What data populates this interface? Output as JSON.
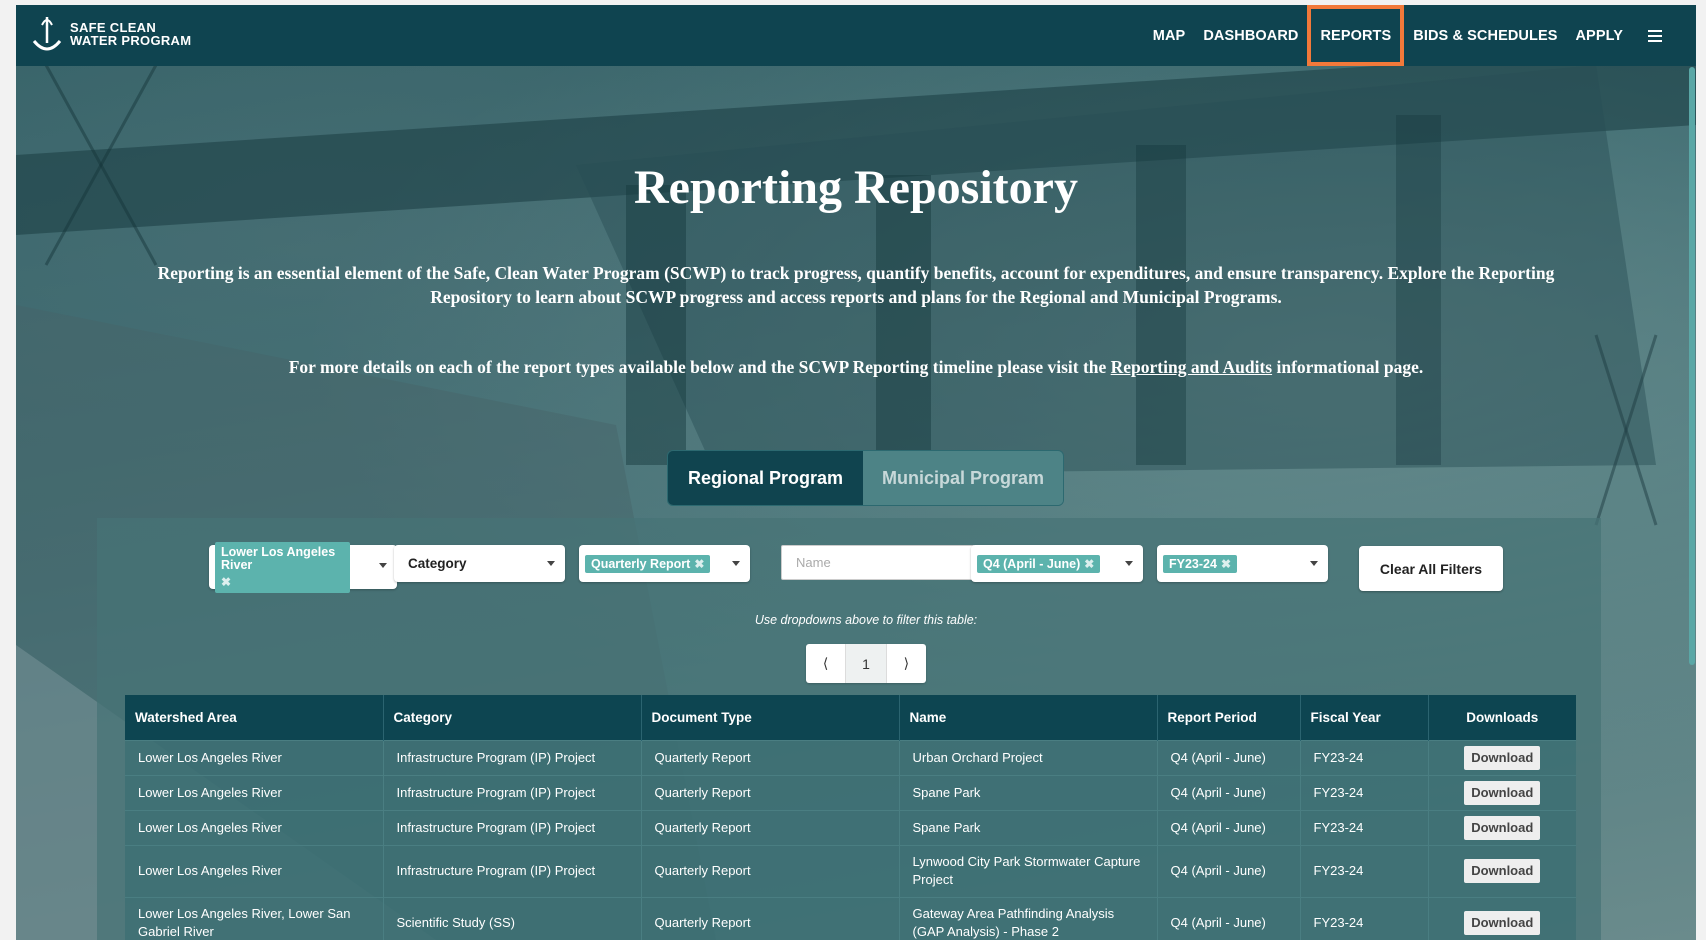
{
  "brand": {
    "logo_text": "SAFE CLEAN\nWATER PROGRAM"
  },
  "nav": {
    "items": [
      "MAP",
      "DASHBOARD",
      "REPORTS",
      "BIDS & SCHEDULES",
      "APPLY"
    ],
    "active": "REPORTS"
  },
  "hero": {
    "title": "Reporting Repository",
    "description": "Reporting is an essential element of the Safe, Clean Water Program (SCWP) to track progress, quantify benefits, account for expenditures, and ensure transparency. Explore the Reporting Repository to learn about SCWP progress and access reports and plans for the Regional and Municipal Programs.",
    "details_prefix": "For more details on each of the report types available below and the SCWP Reporting timeline please visit the",
    "details_link": "Reporting and Audits",
    "details_suffix": "informational page."
  },
  "program_tabs": {
    "regional": "Regional Program",
    "municipal": "Municipal Program"
  },
  "filters": {
    "watershed_chip": "Lower Los Angeles River",
    "category_label": "Category",
    "doc_type_chip": "Quarterly Report",
    "name_placeholder": "Name",
    "period_chip": "Q4 (April - June)",
    "fiscal_chip": "FY23-24",
    "clear_label": "Clear All Filters",
    "chip_remove": "✖"
  },
  "hint": "Use dropdowns above to filter this table:",
  "pager": {
    "prev": "⟨",
    "page": "1",
    "next": "⟩"
  },
  "table": {
    "headers": [
      "Watershed Area",
      "Category",
      "Document Type",
      "Name",
      "Report Period",
      "Fiscal Year",
      "Downloads"
    ],
    "download_label": "Download",
    "rows": [
      {
        "watershed": "Lower Los Angeles River",
        "category": "Infrastructure Program (IP) Project",
        "doc_type": "Quarterly Report",
        "name": "Urban Orchard Project",
        "period": "Q4 (April - June)",
        "fiscal": "FY23-24"
      },
      {
        "watershed": "Lower Los Angeles River",
        "category": "Infrastructure Program (IP) Project",
        "doc_type": "Quarterly Report",
        "name": "Spane Park",
        "period": "Q4 (April - June)",
        "fiscal": "FY23-24"
      },
      {
        "watershed": "Lower Los Angeles River",
        "category": "Infrastructure Program (IP) Project",
        "doc_type": "Quarterly Report",
        "name": "Spane Park",
        "period": "Q4 (April - June)",
        "fiscal": "FY23-24"
      },
      {
        "watershed": "Lower Los Angeles River",
        "category": "Infrastructure Program (IP) Project",
        "doc_type": "Quarterly Report",
        "name": "Lynwood City Park Stormwater Capture Project",
        "period": "Q4 (April - June)",
        "fiscal": "FY23-24"
      },
      {
        "watershed": "Lower Los Angeles River, Lower San Gabriel River",
        "category": "Scientific Study (SS)",
        "doc_type": "Quarterly Report",
        "name": "Gateway Area Pathfinding Analysis (GAP Analysis) - Phase 2",
        "period": "Q4 (April - June)",
        "fiscal": "FY23-24"
      }
    ]
  }
}
